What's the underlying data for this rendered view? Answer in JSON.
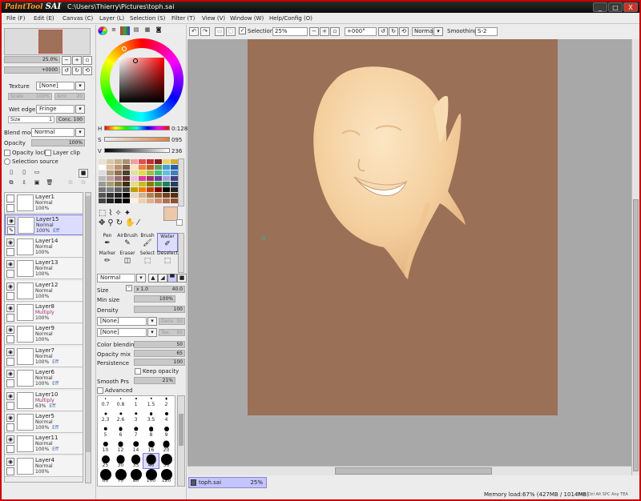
{
  "window": {
    "logo_text": "PaintTool",
    "logo_sai": "SAI",
    "path": "C:\\Users\\Thierry\\Pictures\\toph.sai",
    "min": "_",
    "max": "□",
    "close": "X"
  },
  "menu": [
    "File (F)",
    "Edit (E)",
    "Canvas (C)",
    "Layer (L)",
    "Selection (S)",
    "Filter (T)",
    "View (V)",
    "Window (W)",
    "Help/Config (O)"
  ],
  "toolbar": {
    "selection_label": "Selection",
    "zoom": "25%",
    "rotation": "+000°",
    "mode": "Normal",
    "smoothing_label": "Smoothing",
    "smoothing_value": "S-2"
  },
  "navigator": {
    "zoom_label": "Zoom",
    "zoom_value": "25.0%",
    "angle_label": "Angle",
    "angle_value": "+0000"
  },
  "texture": {
    "label": "Texture",
    "value": "[None]",
    "scale_label": "Scale",
    "scale_value": "100%",
    "amt_label": "Amt",
    "amt_value": "20"
  },
  "wet_edge": {
    "label": "Wet edge",
    "value": "Fringe",
    "size_label": "Size",
    "size_value": "1",
    "conc_label": "Conc.",
    "conc_value": "100"
  },
  "blend": {
    "label": "Blend mode",
    "value": "Normal",
    "opacity_label": "Opacity",
    "opacity_value": "100%"
  },
  "checks": {
    "opacity_lock": "Opacity lock",
    "layer_clip": "Layer clip",
    "selection_source": "Selection source"
  },
  "layers": [
    {
      "name": "Layer1",
      "mode": "Normal",
      "opacity": "100%",
      "eff": "",
      "visible": false
    },
    {
      "name": "Layer15",
      "mode": "Normal",
      "opacity": "100%",
      "eff": "Eff",
      "visible": true
    },
    {
      "name": "Layer14",
      "mode": "Normal",
      "opacity": "100%",
      "eff": "",
      "visible": true
    },
    {
      "name": "Layer13",
      "mode": "Normal",
      "opacity": "100%",
      "eff": "",
      "visible": true
    },
    {
      "name": "Layer12",
      "mode": "Normal",
      "opacity": "100%",
      "eff": "",
      "visible": true
    },
    {
      "name": "Layer8",
      "mode": "Multiply",
      "opacity": "100%",
      "eff": "",
      "visible": true
    },
    {
      "name": "Layer9",
      "mode": "Normal",
      "opacity": "100%",
      "eff": "",
      "visible": true
    },
    {
      "name": "Layer7",
      "mode": "Normal",
      "opacity": "100%",
      "eff": "Eff",
      "visible": true
    },
    {
      "name": "Layer6",
      "mode": "Normal",
      "opacity": "100%",
      "eff": "Eff",
      "visible": true
    },
    {
      "name": "Layer10",
      "mode": "Multiply",
      "opacity": "63%",
      "eff": "Eff",
      "visible": true
    },
    {
      "name": "Layer5",
      "mode": "Normal",
      "opacity": "100%",
      "eff": "Eff",
      "visible": true
    },
    {
      "name": "Layer11",
      "mode": "Normal",
      "opacity": "100%",
      "eff": "Eff",
      "visible": true
    },
    {
      "name": "Layer4",
      "mode": "Normal",
      "opacity": "100%",
      "eff": "",
      "visible": true
    }
  ],
  "color": {
    "h_label": "H",
    "h_value": "0:128",
    "s_label": "S",
    "s_value": "095",
    "v_label": "V",
    "v_value": "236",
    "current": "#ecc8a8"
  },
  "tools": [
    {
      "label": "Pen",
      "glyph": "✒"
    },
    {
      "label": "AirBrush",
      "glyph": "✎"
    },
    {
      "label": "Brush",
      "glyph": "🖌"
    },
    {
      "label": "Water",
      "glyph": "✐"
    },
    {
      "label": "Marker",
      "glyph": "✏"
    },
    {
      "label": "Eraser",
      "glyph": "◫"
    },
    {
      "label": "Select",
      "glyph": "⬚"
    },
    {
      "label": "Deselect",
      "glyph": "⬚"
    }
  ],
  "brush": {
    "mode": "Normal",
    "size_label": "Size",
    "size_mult": "x 1.0",
    "size_value": "40.0",
    "min_size_label": "Min size",
    "min_size_value": "100%",
    "density_label": "Density",
    "density_value": "100",
    "shape1": "[None]",
    "shape1_label": "Dens",
    "shape1_value": "50",
    "shape2": "[None]",
    "shape2_label": "Tex.",
    "shape2_value": "95",
    "color_blending_label": "Color blending",
    "color_blending_value": "50",
    "opacity_mix_label": "Opacity mix",
    "opacity_mix_value": "65",
    "persistence_label": "Persistence",
    "persistence_value": "100",
    "keep_opacity_label": "Keep opacity",
    "smooth_label": "Smooth Prs",
    "smooth_value": "21%",
    "advanced_label": "Advanced"
  },
  "brush_sizes": [
    "0.7",
    "0.8",
    "1",
    "1.5",
    "2",
    "2.3",
    "2.6",
    "3",
    "3.5",
    "4",
    "5",
    "6",
    "7",
    "8",
    "9",
    "10",
    "12",
    "14",
    "16",
    "20",
    "25",
    "30",
    "35",
    "40",
    "50",
    "60",
    "70",
    "80",
    "100",
    "120"
  ],
  "tabs": {
    "file": "toph.sai",
    "zoom": "25%"
  },
  "status": {
    "memory": "Memory load:67% (427MB / 1014MB)",
    "keys": "Shift Ctrl Alt SPC Any TEA"
  }
}
